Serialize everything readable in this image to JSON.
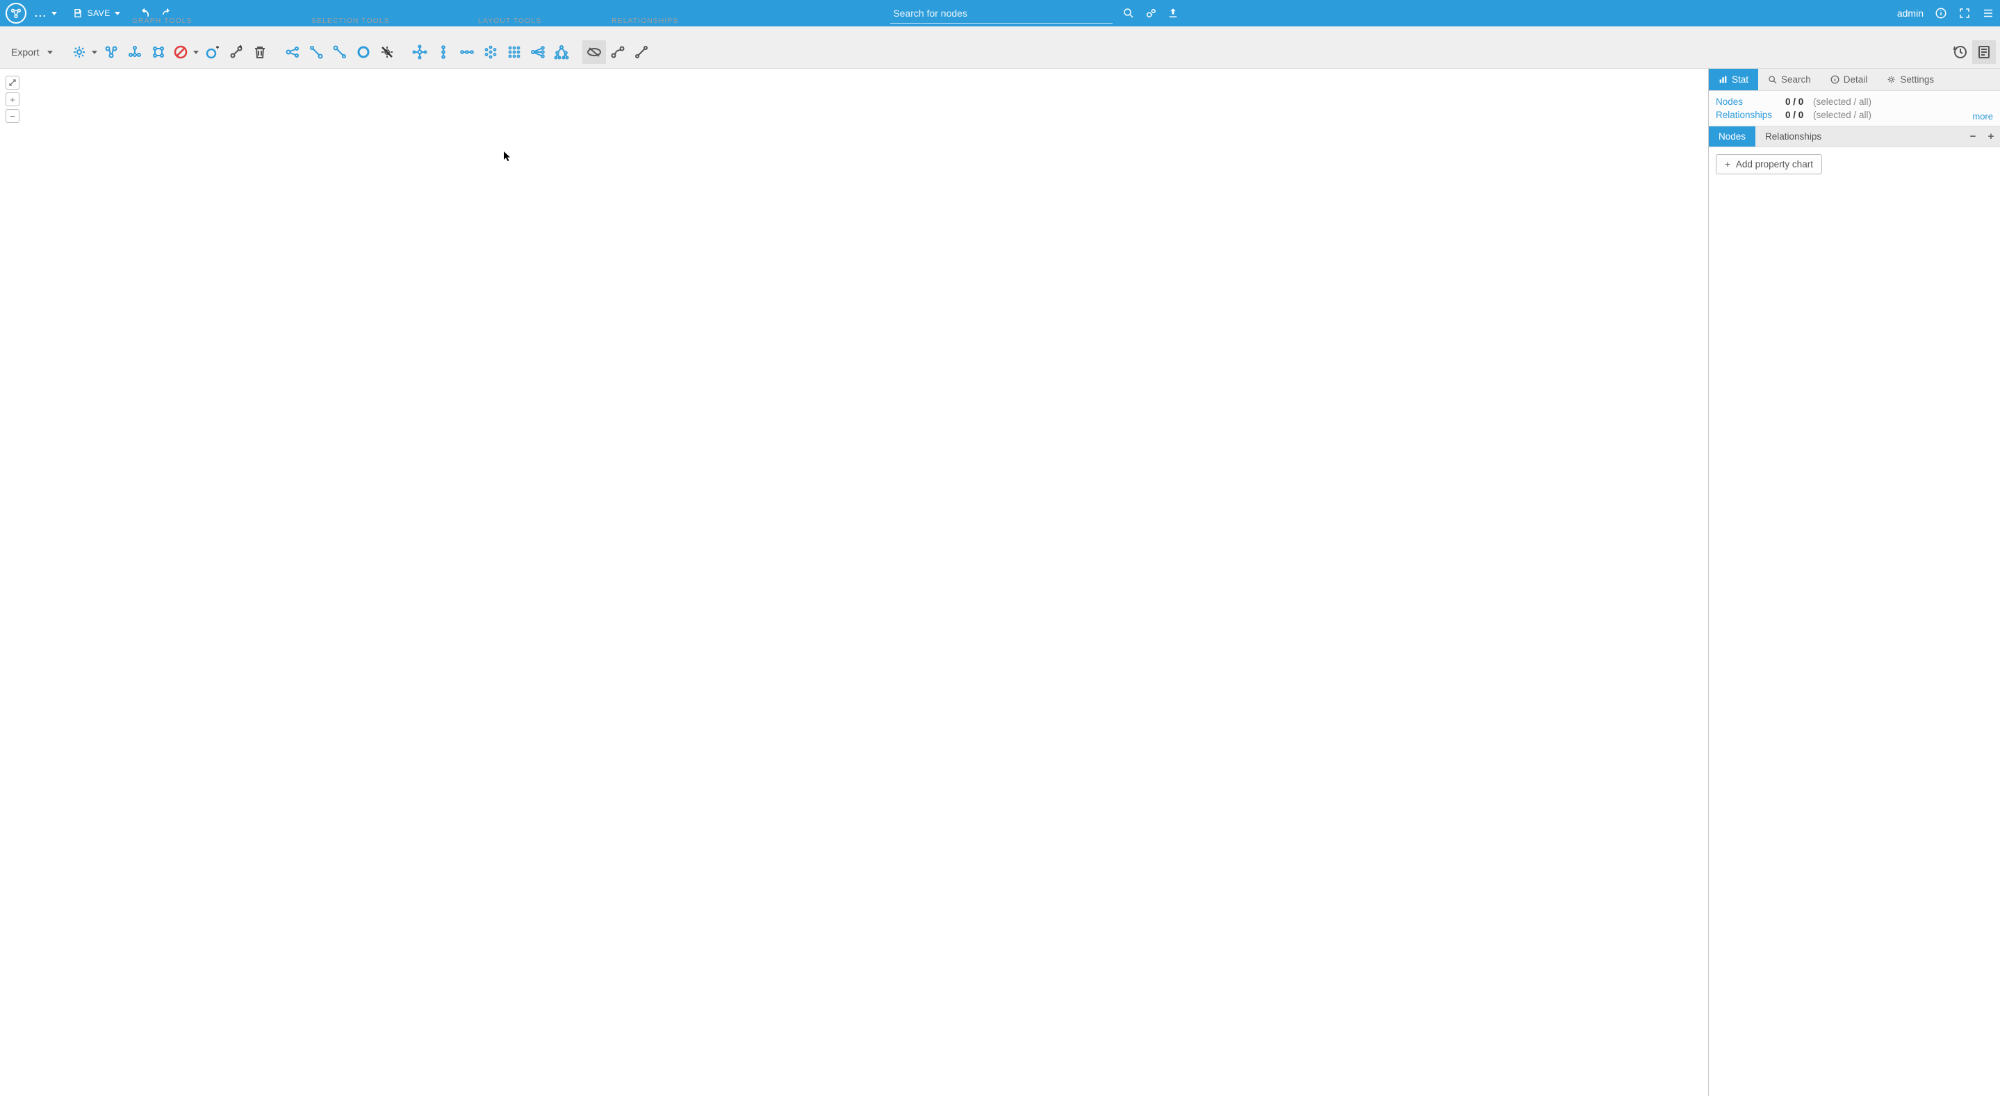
{
  "header": {
    "ellipsis": "...",
    "save_label": "SAVE",
    "search_placeholder": "Search for nodes",
    "user": "admin"
  },
  "toolbar": {
    "export_label": "Export",
    "section_graph": "GRAPH TOOLS",
    "section_selection": "SELECTION TOOLS",
    "section_layout": "LAYOUT TOOLS",
    "section_relationships": "RELATIONSHIPS"
  },
  "sidepanel": {
    "tabs": {
      "stat": "Stat",
      "search": "Search",
      "detail": "Detail",
      "settings": "Settings"
    },
    "stats": {
      "nodes_label": "Nodes",
      "relationships_label": "Relationships",
      "nodes_value": "0 / 0",
      "relationships_value": "0 / 0",
      "note": "(selected / all)",
      "more": "more"
    },
    "subtabs": {
      "nodes": "Nodes",
      "relationships": "Relationships"
    },
    "add_chart_label": "Add property chart"
  },
  "vtools": {
    "plus": "+",
    "minus": "−"
  }
}
